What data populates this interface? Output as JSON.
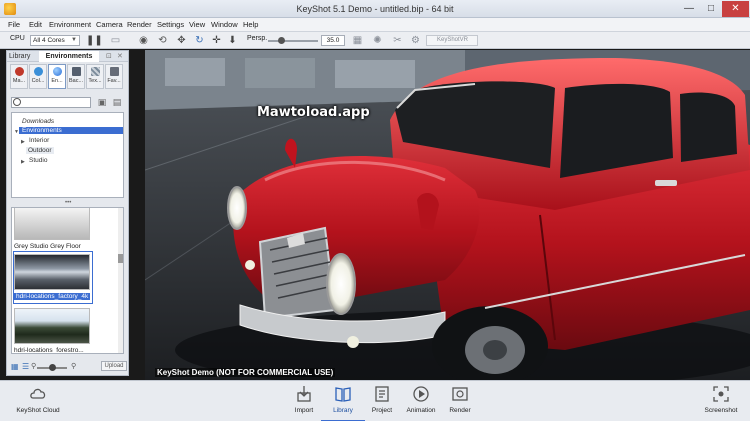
{
  "window": {
    "title": "KeyShot 5.1 Demo  -  untitled.bip  -  64 bit",
    "minimize": "—",
    "maximize": "□",
    "close": "✕"
  },
  "menu": [
    "File",
    "Edit",
    "Environment",
    "Camera",
    "Render",
    "Settings",
    "View",
    "Window",
    "Help"
  ],
  "toolbar": {
    "cpu_label": "CPU",
    "cpu_value": "All 4 Cores",
    "persp_label": "Persp.",
    "persp_value": "35.0",
    "keyshotvr_label": "KeyShotVR"
  },
  "library": {
    "title": "Library",
    "active_tab": "Environments",
    "tabs": [
      {
        "label": "Ma...",
        "icon": "materials-icon",
        "color": "#c0392b"
      },
      {
        "label": "Col...",
        "icon": "colors-icon",
        "color": "#3a8fd8"
      },
      {
        "label": "En...",
        "icon": "environments-icon",
        "color": "#2a6fd8"
      },
      {
        "label": "Bac...",
        "icon": "backplates-icon",
        "color": "#555f6e"
      },
      {
        "label": "Tex...",
        "icon": "textures-icon",
        "color": "#7a8a9a"
      },
      {
        "label": "Fav...",
        "icon": "favorites-icon",
        "color": "#666c78"
      }
    ],
    "search_placeholder": "",
    "tree": {
      "downloads": "Downloads",
      "environments": "Environments",
      "interior": "Interior",
      "outdoor": "Outdoor",
      "studio": "Studio"
    },
    "thumbnails": [
      {
        "label": "Grey Studio Grey Floor"
      },
      {
        "label": "hdri-locations_factory_4k"
      },
      {
        "label": "hdri-locations_forestro..."
      }
    ],
    "upload_label": "Upload"
  },
  "viewport": {
    "watermark": "Mawtoload.app",
    "demo_notice": "KeyShot Demo (NOT FOR COMMERCIAL USE)",
    "car_color": "#b3121c"
  },
  "bottombar": {
    "keyshot_cloud": "KeyShot Cloud",
    "import": "Import",
    "library": "Library",
    "project": "Project",
    "animation": "Animation",
    "render": "Render",
    "screenshot": "Screenshot"
  }
}
